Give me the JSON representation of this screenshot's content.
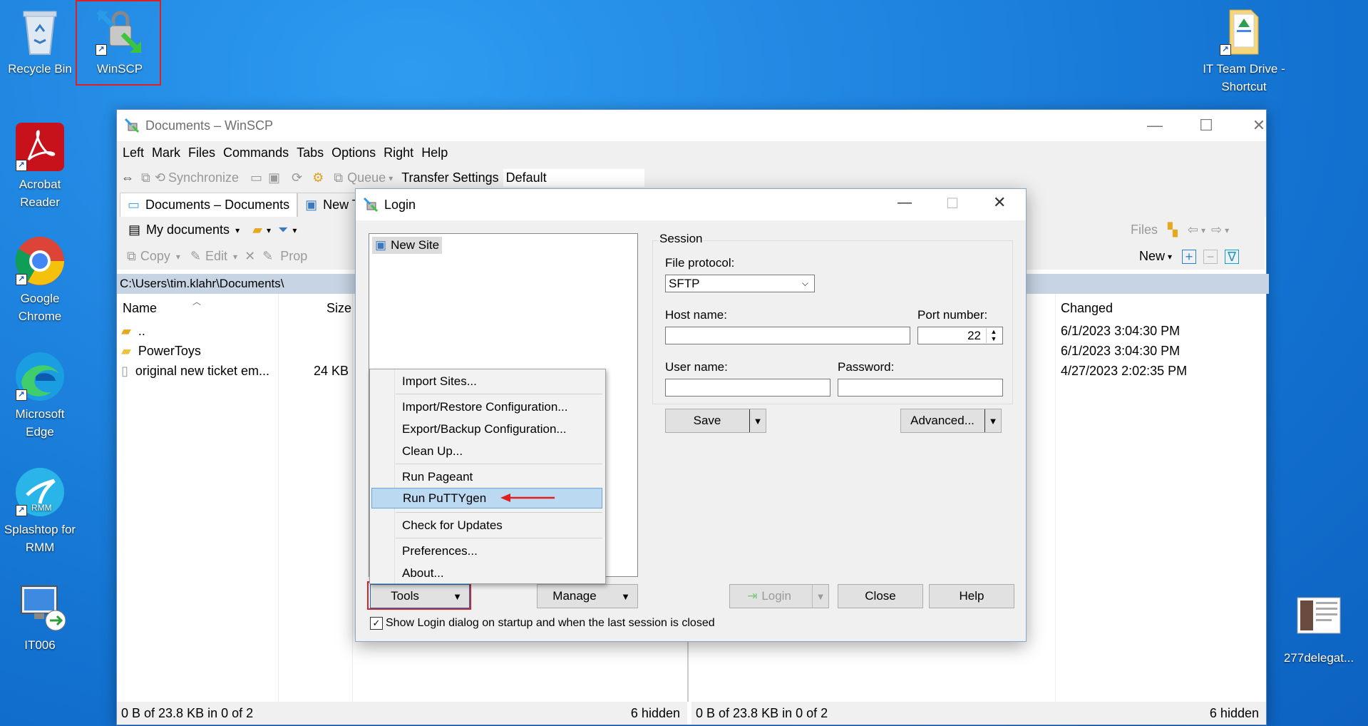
{
  "desktop": {
    "icons": [
      {
        "label": "Recycle Bin",
        "icon": "recycle-bin-icon"
      },
      {
        "label": "WinSCP",
        "icon": "winscp-icon"
      },
      {
        "label": "Acrobat Reader",
        "icon": "acrobat-icon"
      },
      {
        "label": "Google Chrome",
        "icon": "chrome-icon"
      },
      {
        "label": "Microsoft Edge",
        "icon": "edge-icon"
      },
      {
        "label": "Splashtop for RMM",
        "icon": "splashtop-icon"
      },
      {
        "label": "IT006",
        "icon": "remote-desktop-icon"
      },
      {
        "label": "IT Team Drive - Shortcut",
        "icon": "folder-icon"
      },
      {
        "label": "277delegat...",
        "icon": "document-thumbnail-icon"
      }
    ],
    "splashtop_badge": "RMM"
  },
  "main_window": {
    "title": "Documents – WinSCP",
    "menu": [
      "Left",
      "Mark",
      "Files",
      "Commands",
      "Tabs",
      "Options",
      "Right",
      "Help"
    ],
    "toolbar": {
      "synchronize": "Synchronize",
      "queue": "Queue",
      "transfer_settings_label": "Transfer Settings",
      "transfer_settings_value": "Default"
    },
    "tabs": [
      "Documents – Documents",
      "New Ta"
    ],
    "left_panel": {
      "location": "My documents",
      "actions": {
        "copy": "Copy",
        "edit": "Edit",
        "properties": "Prop"
      },
      "path": "C:\\Users\\tim.klahr\\Documents\\",
      "columns": {
        "name": "Name",
        "size": "Size"
      },
      "rows": [
        {
          "name": "..",
          "size": ""
        },
        {
          "name": "PowerToys",
          "size": ""
        },
        {
          "name": "original new ticket em...",
          "size": "24 KB"
        }
      ],
      "status_left": "0 B of 23.8 KB in 0 of 2",
      "status_right": "6 hidden"
    },
    "right_panel": {
      "files_label": "Files",
      "new_label": "New",
      "columns": {
        "changed": "Changed"
      },
      "rows": [
        {
          "changed": "6/1/2023 3:04:30 PM"
        },
        {
          "changed": "6/1/2023 3:04:30 PM"
        },
        {
          "changed": "4/27/2023 2:02:35 PM"
        }
      ],
      "status_left": "0 B of 23.8 KB in 0 of 2",
      "status_right": "6 hidden"
    }
  },
  "login_dialog": {
    "title": "Login",
    "site_tree": [
      "New Site"
    ],
    "session": {
      "group_label": "Session",
      "file_protocol_label": "File protocol:",
      "file_protocol_value": "SFTP",
      "host_label": "Host name:",
      "host_value": "",
      "port_label": "Port number:",
      "port_value": "22",
      "user_label": "User name:",
      "user_value": "",
      "password_label": "Password:",
      "password_value": "",
      "save_button": "Save",
      "advanced_button": "Advanced..."
    },
    "buttons": {
      "tools": "Tools",
      "manage": "Manage",
      "login": "Login",
      "close": "Close",
      "help": "Help"
    },
    "startup_checkbox": {
      "label": "Show Login dialog on startup and when the last session is closed",
      "checked": true
    }
  },
  "tools_menu": {
    "groups": [
      [
        "Import Sites..."
      ],
      [
        "Import/Restore Configuration...",
        "Export/Backup Configuration...",
        "Clean Up..."
      ],
      [
        "Run Pageant",
        "Run PuTTYgen"
      ],
      [
        "Check for Updates"
      ],
      [
        "Preferences...",
        "About..."
      ]
    ],
    "highlighted": "Run PuTTYgen"
  },
  "colors": {
    "annotation_red": "#e02020",
    "menu_highlight": "#bcd9f2",
    "path_bar": "#c6d4e3"
  }
}
